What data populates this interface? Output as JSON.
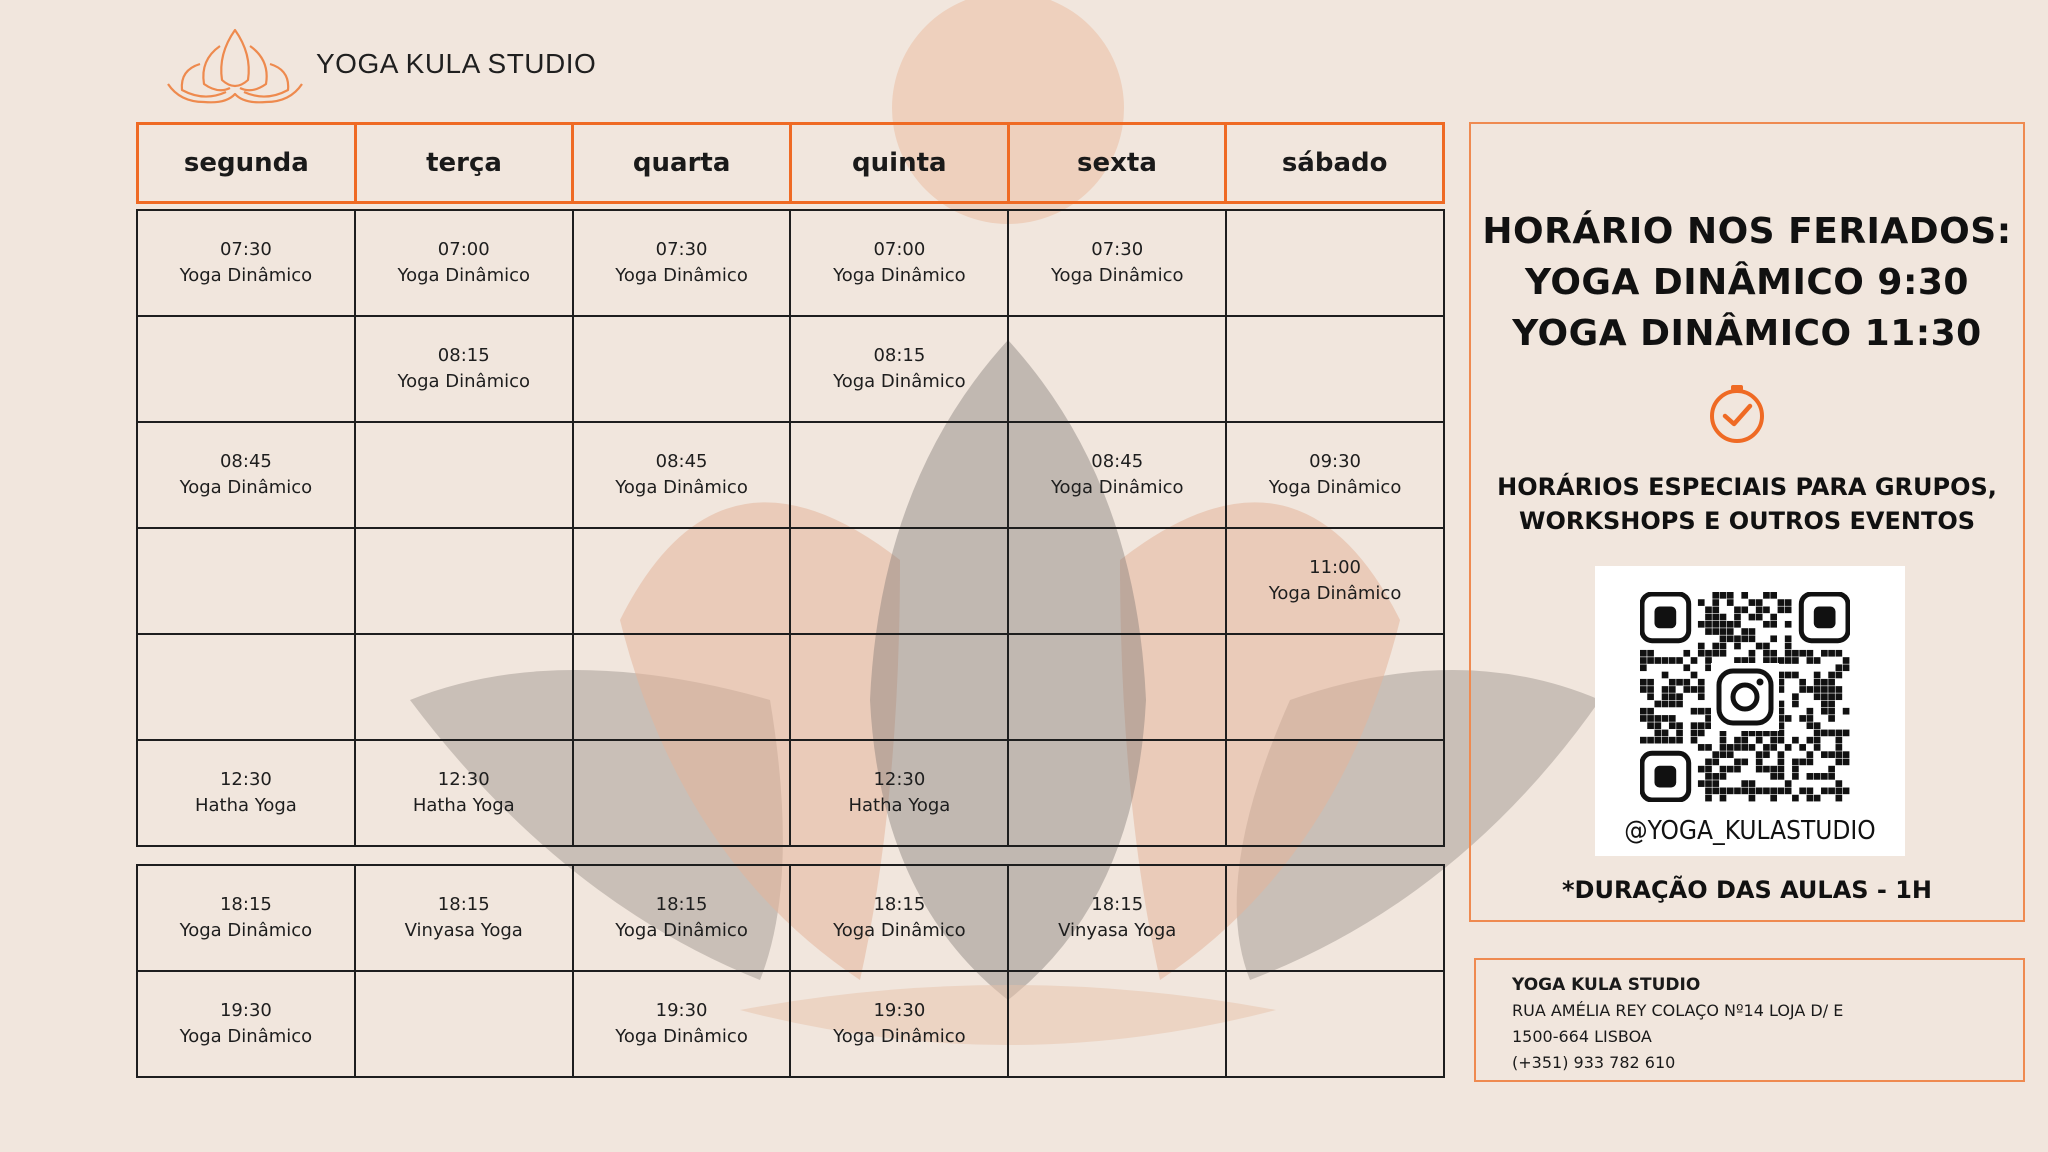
{
  "brand": {
    "name": "YOGA KULA STUDIO",
    "accent_color": "#ef6a24",
    "logo_icon": "lotus-icon"
  },
  "days": [
    "segunda",
    "terça",
    "quarta",
    "quinta",
    "sexta",
    "sábado"
  ],
  "morning_rows": [
    [
      {
        "time": "07:30",
        "class": "Yoga Dinâmico"
      },
      {
        "time": "07:00",
        "class": "Yoga Dinâmico"
      },
      {
        "time": "07:30",
        "class": "Yoga Dinâmico"
      },
      {
        "time": "07:00",
        "class": "Yoga Dinâmico"
      },
      {
        "time": "07:30",
        "class": "Yoga Dinâmico"
      },
      null
    ],
    [
      null,
      {
        "time": "08:15",
        "class": "Yoga Dinâmico"
      },
      null,
      {
        "time": "08:15",
        "class": "Yoga Dinâmico"
      },
      null,
      null
    ],
    [
      {
        "time": "08:45",
        "class": "Yoga Dinâmico"
      },
      null,
      {
        "time": "08:45",
        "class": "Yoga Dinâmico"
      },
      null,
      {
        "time": "08:45",
        "class": "Yoga Dinâmico"
      },
      {
        "time": "09:30",
        "class": "Yoga Dinâmico"
      }
    ],
    [
      null,
      null,
      null,
      null,
      null,
      {
        "time": "11:00",
        "class": "Yoga Dinâmico"
      }
    ],
    [
      null,
      null,
      null,
      null,
      null,
      null
    ],
    [
      {
        "time": "12:30",
        "class": "Hatha Yoga"
      },
      {
        "time": "12:30",
        "class": "Hatha Yoga"
      },
      null,
      {
        "time": "12:30",
        "class": "Hatha Yoga"
      },
      null,
      null
    ]
  ],
  "evening_rows": [
    [
      {
        "time": "18:15",
        "class": "Yoga Dinâmico"
      },
      {
        "time": "18:15",
        "class": "Vinyasa Yoga"
      },
      {
        "time": "18:15",
        "class": "Yoga Dinâmico"
      },
      {
        "time": "18:15",
        "class": "Yoga Dinâmico"
      },
      {
        "time": "18:15",
        "class": "Vinyasa Yoga"
      },
      null
    ],
    [
      {
        "time": "19:30",
        "class": "Yoga Dinâmico"
      },
      null,
      {
        "time": "19:30",
        "class": "Yoga Dinâmico"
      },
      {
        "time": "19:30",
        "class": "Yoga Dinâmico"
      },
      null,
      null
    ]
  ],
  "info": {
    "holiday_lines": [
      "HORÁRIO NOS FERIADOS:",
      "YOGA DINÂMICO 9:30",
      "YOGA DINÂMICO 11:30"
    ],
    "clock_icon": "clock-check-icon",
    "special_lines": [
      "HORÁRIOS ESPECIAIS PARA GRUPOS,",
      "WORKSHOPS E OUTROS EVENTOS"
    ],
    "qr_icon": "instagram-icon",
    "instagram_handle": "@YOGA_KULASTUDIO",
    "duration_note": "*DURAÇÃO DAS AULAS - 1H"
  },
  "address": {
    "name": "YOGA KULA STUDIO",
    "street": "RUA AMÉLIA REY COLAÇO Nº14 LOJA D/ E",
    "postal": "1500-664 LISBOA",
    "phone": "(+351) 933 782 610"
  }
}
